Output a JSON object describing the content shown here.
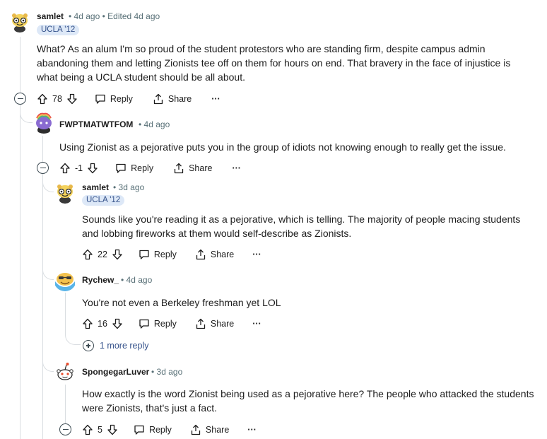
{
  "comments": [
    {
      "id": "c1",
      "username": "samlet",
      "time": "4d ago",
      "edited": "Edited 4d ago",
      "flair": "UCLA '12",
      "body_line1": "What? As an alum I'm so proud of the student protestors who are standing firm, despite campus admin",
      "body_line2": "abandoning them and letting Zionists tee off on them for hours on end. That bravery in the face of injustice is",
      "body_line3": "what being a UCLA student should be all about.",
      "votes": "78",
      "reply_label": "Reply",
      "share_label": "Share",
      "more_label": "···",
      "avatar_icon": "snoo-glasses-avatar-icon"
    },
    {
      "id": "c2",
      "username": "FWPTMATWTFOM",
      "time": "4d ago",
      "body_line1": "Using Zionist as a pejorative puts you in the group of idiots not knowing enough to really get the issue.",
      "votes": "-1",
      "reply_label": "Reply",
      "share_label": "Share",
      "more_label": "···",
      "avatar_icon": "snoo-rainbow-hair-avatar-icon"
    },
    {
      "id": "c3",
      "username": "samlet",
      "time": "3d ago",
      "flair": "UCLA '12",
      "body_line1": "Sounds like you're reading it as a pejorative, which is telling. The majority of people macing students",
      "body_line2": "and lobbing fireworks at them would self-describe as Zionists.",
      "votes": "22",
      "reply_label": "Reply",
      "share_label": "Share",
      "more_label": "···",
      "avatar_icon": "snoo-glasses-avatar-icon"
    },
    {
      "id": "c4",
      "username": "Rychew_",
      "time": "4d ago",
      "body_line1": "You're not even a Berkeley freshman yet LOL",
      "votes": "16",
      "reply_label": "Reply",
      "share_label": "Share",
      "more_label": "···",
      "more_replies": "1 more reply",
      "avatar_icon": "snoo-sunglasses-avatar-icon"
    },
    {
      "id": "c5",
      "username": "SpongegarLuver",
      "time": "3d ago",
      "body_line1": "How exactly is the word Zionist being used as a pejorative here? The people who attacked the students",
      "body_line2": "were Zionists, that's just a fact.",
      "votes": "5",
      "reply_label": "Reply",
      "share_label": "Share",
      "more_label": "···",
      "avatar_icon": "default-snoo-avatar-icon"
    }
  ],
  "separator": "•",
  "colors": {
    "meta_gray": "#576f76",
    "flair_bg": "#dde8f7",
    "flair_text": "#34518a",
    "thread_line": "#d9dde1"
  }
}
